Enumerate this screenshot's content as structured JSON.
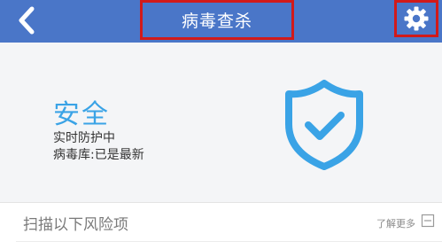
{
  "header": {
    "title": "病毒查杀",
    "back_icon": "chevron-left-icon",
    "settings_icon": "gear-icon",
    "background_color": "#4a76c8",
    "highlight_color": "#d11a1a"
  },
  "status": {
    "title": "安全",
    "realtime_protection": "实时防护中",
    "virus_db": "病毒库:已是最新",
    "shield_icon": "shield-check-icon",
    "accent_color": "#3aa3e6"
  },
  "scan": {
    "label": "扫描以下风险项",
    "learn_more": "了解更多"
  }
}
